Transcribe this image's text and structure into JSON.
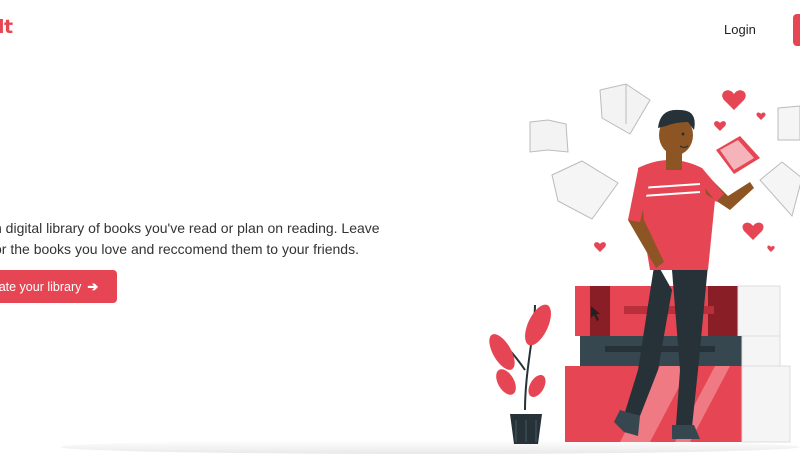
{
  "header": {
    "logo_text": "lt",
    "login_label": "Login"
  },
  "hero": {
    "description_line1": "n digital library of books you've read or plan on reading. Leave",
    "description_line2": "or the books you love and reccomend them to your friends.",
    "cta_label": "ate your library",
    "cta_icon": "arrow-right-icon"
  },
  "colors": {
    "accent": "#e64553",
    "dark": "#263238",
    "text": "#333333"
  }
}
